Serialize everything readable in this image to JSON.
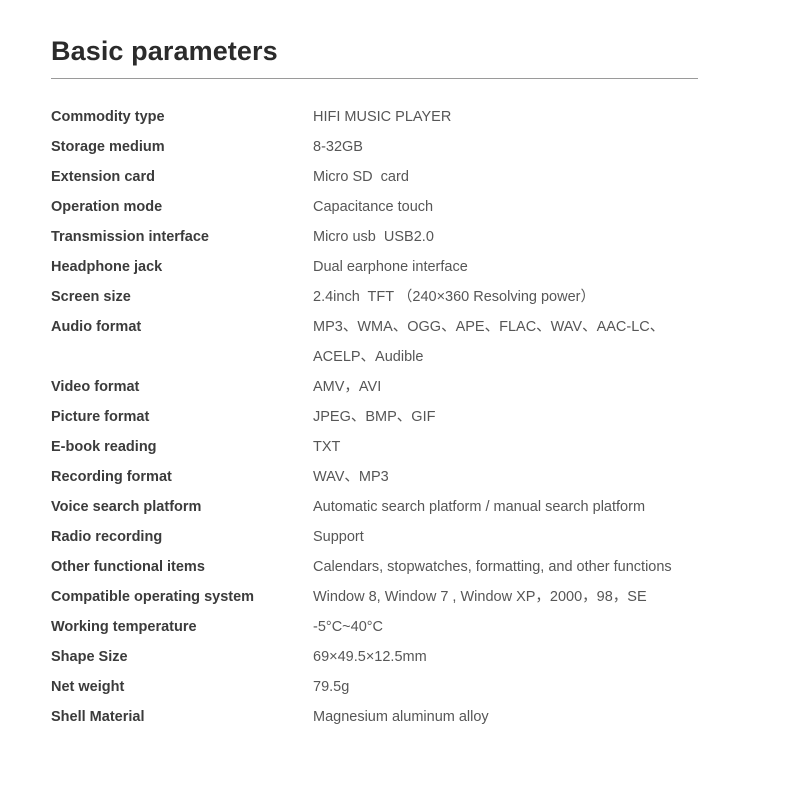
{
  "document": {
    "title": "Basic parameters",
    "rows": [
      {
        "label": "Commodity type",
        "value": "HIFI MUSIC PLAYER"
      },
      {
        "label": "Storage medium",
        "value": "8-32GB"
      },
      {
        "label": "Extension card",
        "value": "Micro SD  card"
      },
      {
        "label": "Operation mode",
        "value": "Capacitance touch"
      },
      {
        "label": "Transmission interface",
        "value": "Micro usb  USB2.0"
      },
      {
        "label": "Headphone jack",
        "value": "Dual earphone interface"
      },
      {
        "label": "Screen size",
        "value": "2.4inch  TFT （240×360 Resolving power）"
      },
      {
        "label": "Audio format",
        "value": "MP3、WMA、OGG、APE、FLAC、WAV、AAC-LC、",
        "value_line2": "ACELP、Audible"
      },
      {
        "label": "Video format",
        "value": "AMV，AVI"
      },
      {
        "label": "Picture format",
        "value": "JPEG、BMP、GIF"
      },
      {
        "label": "E-book reading",
        "value": "TXT"
      },
      {
        "label": "Recording format",
        "value": "WAV、MP3"
      },
      {
        "label": "Voice search platform",
        "value": "Automatic search platform / manual search platform"
      },
      {
        "label": "Radio recording",
        "value": "Support"
      },
      {
        "label": "Other functional items",
        "value": "Calendars, stopwatches, formatting, and other functions"
      },
      {
        "label": "Compatible operating system",
        "value": "Window 8, Window 7 , Window XP，2000，98，SE"
      },
      {
        "label": "Working temperature",
        "value": "-5°C~40°C"
      },
      {
        "label": "Shape Size",
        "value": "69×49.5×12.5mm"
      },
      {
        "label": "Net weight",
        "value": "79.5g"
      },
      {
        "label": "Shell Material",
        "value": "Magnesium aluminum alloy"
      }
    ]
  },
  "colors": {
    "background": "#ffffff",
    "title_text": "#2b2b2b",
    "label_text": "#3b3b3b",
    "value_text": "#565656",
    "rule": "#9a9a9a"
  }
}
